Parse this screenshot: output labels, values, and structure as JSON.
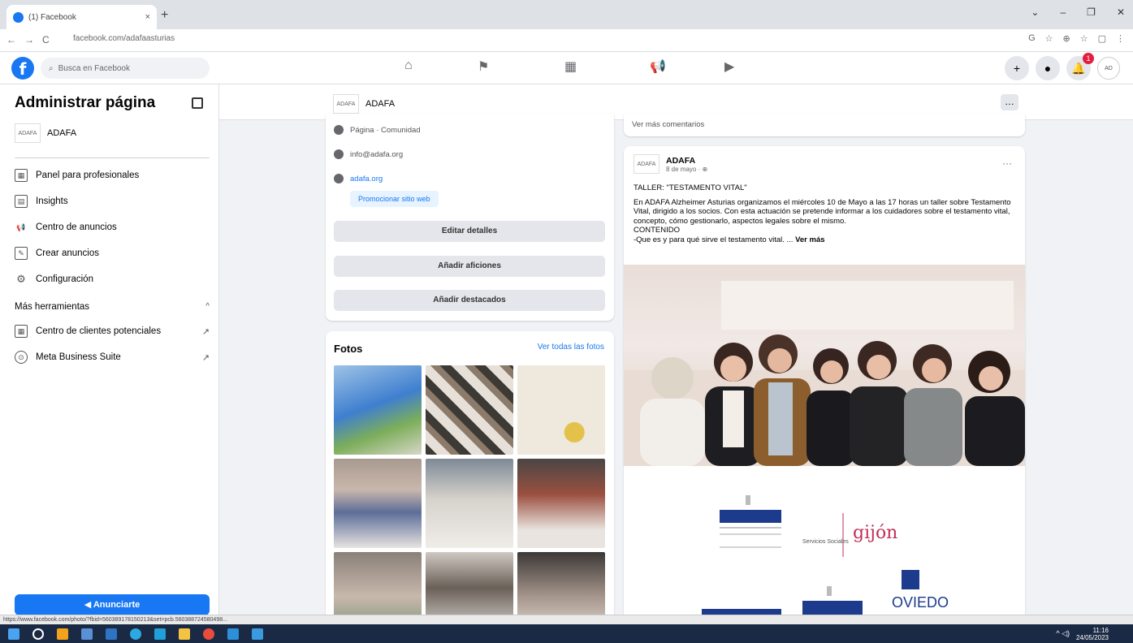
{
  "browser": {
    "tab_title": "(1) Facebook",
    "tab_close": "×",
    "new_tab": "+",
    "url": "facebook.com/adafaasturias",
    "window_controls": [
      "⌄",
      "–",
      "❐",
      "✕"
    ],
    "nav": [
      "←",
      "→",
      "C"
    ],
    "toolbar_icons": [
      "G",
      "☆",
      "⊕",
      "☆",
      "▢",
      "⋮"
    ]
  },
  "fb": {
    "logo": "f",
    "search_placeholder": "Busca en Facebook",
    "search_icon": "magnifier",
    "nav_icons": [
      "⌂",
      "⚑",
      "▦",
      "📢",
      "▶"
    ],
    "right_icons": [
      "+",
      "●",
      "🔔"
    ],
    "notification_count": "1"
  },
  "sidebar": {
    "title": "Administrar página",
    "page_name": "ADAFA",
    "items": [
      {
        "label": "Panel para profesionales",
        "icon": "▦"
      },
      {
        "label": "Insights",
        "icon": "▤"
      },
      {
        "label": "Centro de anuncios",
        "icon": "📢"
      },
      {
        "label": "Crear anuncios",
        "icon": "✎"
      },
      {
        "label": "Configuración",
        "icon": "⚙"
      }
    ],
    "more_tools": "Más herramientas",
    "tools": [
      {
        "label": "Centro de clientes potenciales",
        "arrow": "↗"
      },
      {
        "label": "Meta Business Suite",
        "arrow": "↗"
      }
    ],
    "button_label": "Anunciarte"
  },
  "pagebar": {
    "page_name": "ADAFA",
    "more": "…"
  },
  "intro": {
    "category": "Página · Comunidad",
    "email": "info@adafa.org",
    "website": "adafa.org",
    "promote": "Promocionar sitio web",
    "buttons": [
      "Editar detalles",
      "Añadir aficiones",
      "Añadir destacados"
    ]
  },
  "photos": {
    "title": "Fotos",
    "see_all": "Ver todas las fotos"
  },
  "post": {
    "more_comments": "Ver más comentarios",
    "author": "ADAFA",
    "date": "8 de mayo · ⊕",
    "menu": "···",
    "title_line": "TALLER: \"TESTAMENTO VITAL\"",
    "body": "En ADAFA Alzheimer Asturias organizamos el miércoles 10 de Mayo a las 17 horas un taller sobre Testamento Vital, dirigido a los socios. Con esta actuación se pretende informar a los cuidadores sobre el testamento vital, concepto, cómo gestionarlo, aspectos legales sobre el mismo.",
    "contenido": "CONTENIDO",
    "teaser": "-Que es y para qué sirve el testamento vital. ...",
    "see_more": "Ver más",
    "logos": {
      "servicios": "Servicios Sociales",
      "gijon": "gijón",
      "oviedo": "OVIEDO"
    }
  },
  "statusbar": "https://www.facebook.com/photo/?fbid=560389178150213&set=pcb.560388724580498...",
  "taskbar": {
    "time": "11:16",
    "date": "24/05/2023",
    "tray": "^ ◁)"
  }
}
